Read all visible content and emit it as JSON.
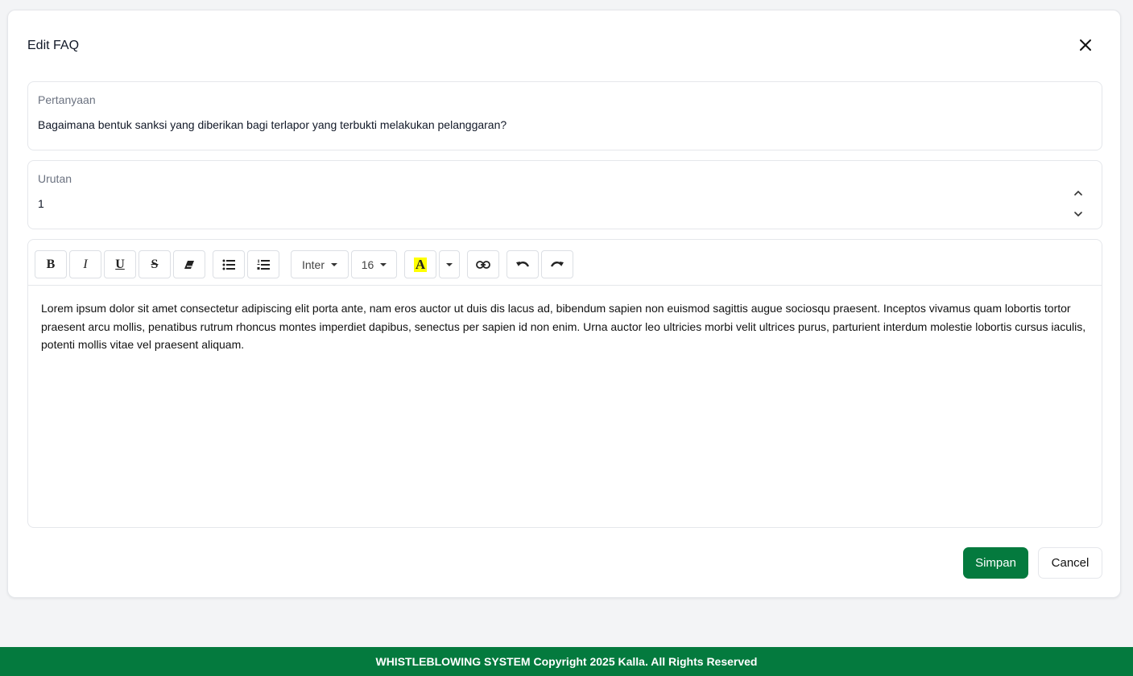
{
  "modal": {
    "title": "Edit FAQ",
    "close_icon": "close-icon"
  },
  "question": {
    "label": "Pertanyaan",
    "value": "Bagaimana bentuk sanksi yang diberikan bagi terlapor yang terbukti melakukan pelanggaran?"
  },
  "order": {
    "label": "Urutan",
    "value": "1"
  },
  "toolbar": {
    "bold": "B",
    "italic": "I",
    "underline": "U",
    "strikethrough": "S",
    "font_family": "Inter",
    "font_size": "16",
    "highlight_letter": "A",
    "highlight_color": "#ffff00",
    "icons": [
      "bold-icon",
      "italic-icon",
      "underline-icon",
      "strikethrough-icon",
      "eraser-icon",
      "bullet-list-icon",
      "numbered-list-icon",
      "highlight-icon",
      "link-icon",
      "undo-icon",
      "redo-icon"
    ]
  },
  "editor": {
    "content": "Lorem ipsum dolor sit amet consectetur adipiscing elit porta ante, nam eros auctor ut duis dis lacus ad, bibendum sapien non euismod sagittis augue sociosqu praesent. Inceptos vivamus quam lobortis tortor praesent arcu mollis, penatibus rutrum rhoncus montes imperdiet dapibus, senectus per sapien id non enim. Urna auctor leo ultricies morbi velit ultrices purus, parturient interdum molestie lobortis cursus iaculis, potenti mollis vitae vel praesent aliquam."
  },
  "actions": {
    "save": "Simpan",
    "cancel": "Cancel"
  },
  "footer": {
    "text": "WHISTLEBLOWING SYSTEM Copyright 2025 Kalla. All Rights Reserved"
  },
  "colors": {
    "primary": "#047a3e",
    "page_bg": "#f3f4f6",
    "border": "#e5e7eb"
  }
}
